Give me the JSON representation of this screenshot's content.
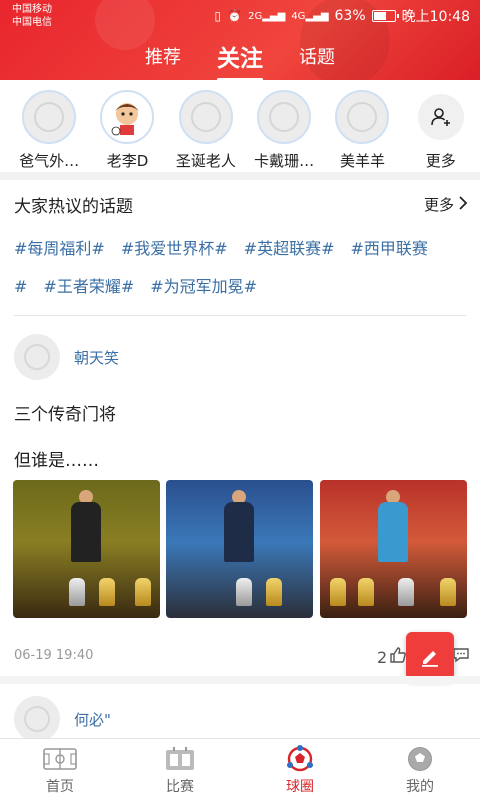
{
  "status_bar": {
    "carrier1": "中国移动",
    "carrier2": "中国电信",
    "network1": "2G",
    "network2": "4G",
    "battery": "63%",
    "battery_level": 0.63,
    "time": "晚上10:48"
  },
  "header": {
    "tabs": [
      {
        "label": "推荐",
        "active": false
      },
      {
        "label": "关注",
        "active": true
      },
      {
        "label": "话题",
        "active": false
      }
    ],
    "accent_color": "#e8262d"
  },
  "follow": {
    "users": [
      {
        "name": "爸气外…"
      },
      {
        "name": "老李D"
      },
      {
        "name": "圣诞老人"
      },
      {
        "name": "卡戴珊…"
      },
      {
        "name": "美羊羊"
      }
    ],
    "more_label": "更多"
  },
  "topics": {
    "title": "大家热议的话题",
    "more_label": "更多",
    "tags": [
      "#每周福利#",
      "#我爱世界杯#",
      "#英超联赛#",
      "#西甲联赛#",
      "#王者荣耀#",
      "#为冠军加冕#"
    ]
  },
  "post": {
    "username": "朝天笑",
    "line1": "三个传奇门将",
    "line2": "但谁是……",
    "time": "06-19 19:40",
    "likes": "2"
  },
  "post2": {
    "username": "何必\""
  },
  "bottom_nav": [
    {
      "label": "首页",
      "active": false
    },
    {
      "label": "比赛",
      "active": false
    },
    {
      "label": "球圈",
      "active": true
    },
    {
      "label": "我的",
      "active": false
    }
  ]
}
